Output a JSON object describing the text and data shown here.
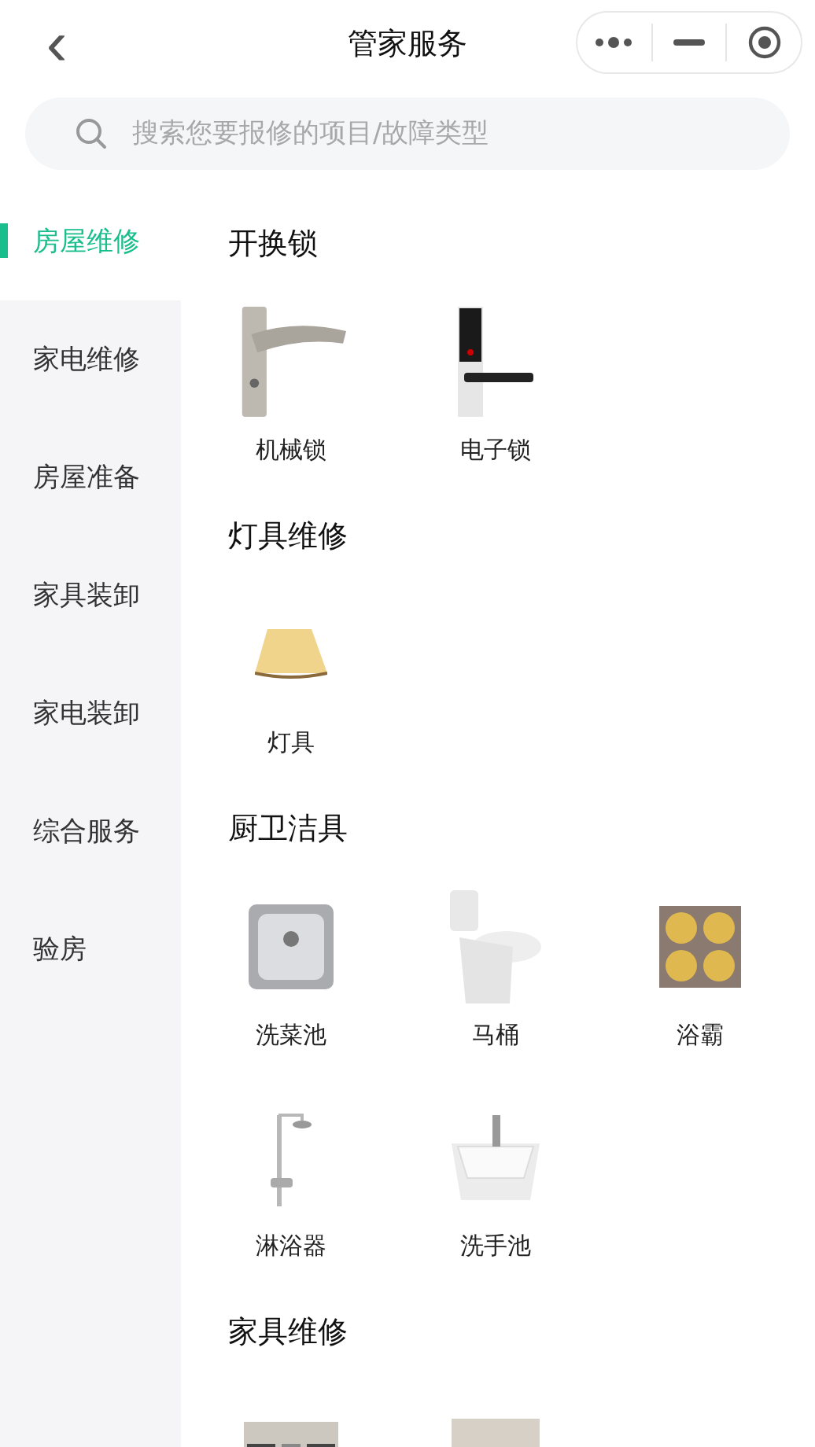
{
  "header": {
    "back": "‹",
    "title": "管家服务"
  },
  "search": {
    "placeholder": "搜索您要报修的项目/故障类型"
  },
  "sidebar": {
    "items": [
      {
        "label": "房屋维修",
        "selected": true
      },
      {
        "label": "家电维修",
        "selected": false
      },
      {
        "label": "房屋准备",
        "selected": false
      },
      {
        "label": "家具装卸",
        "selected": false
      },
      {
        "label": "家电装卸",
        "selected": false
      },
      {
        "label": "综合服务",
        "selected": false
      },
      {
        "label": "验房",
        "selected": false
      }
    ]
  },
  "sections": [
    {
      "title": "开换锁",
      "items": [
        {
          "kind": "picture",
          "label": "机械锁"
        },
        {
          "kind": "picture",
          "label": "电子锁"
        }
      ]
    },
    {
      "title": "灯具维修",
      "items": [
        {
          "kind": "picture",
          "label": "灯具"
        }
      ]
    },
    {
      "title": "厨卫洁具",
      "items": [
        {
          "kind": "picture",
          "label": "洗菜池"
        },
        {
          "kind": "picture",
          "label": "马桶"
        },
        {
          "kind": "picture",
          "label": "浴霸"
        },
        {
          "kind": "picture",
          "label": "淋浴器"
        },
        {
          "kind": "picture",
          "label": "洗手池"
        }
      ]
    },
    {
      "title": "家具维修"
    }
  ]
}
